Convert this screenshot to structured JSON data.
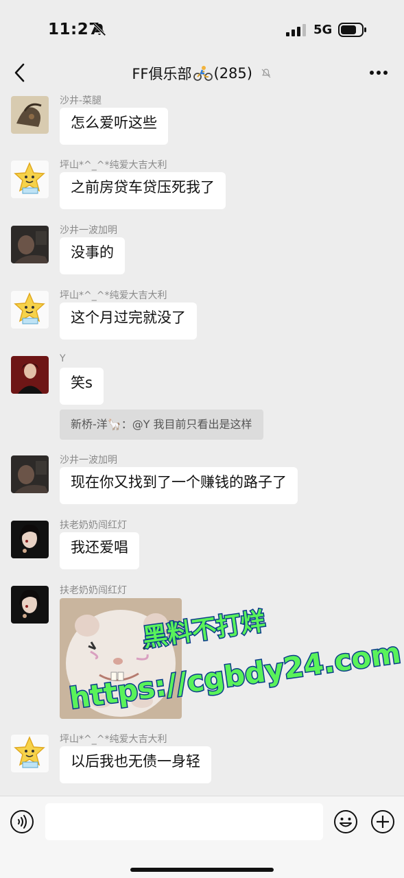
{
  "status_bar": {
    "time": "11:27",
    "network": "5G"
  },
  "header": {
    "group_name": "FF俱乐部",
    "member_count": "(285)"
  },
  "colors": {
    "background": "#ededed",
    "bubble": "#ffffff",
    "quote": "#dcdcdc",
    "sender": "#8a8a8a"
  },
  "messages": [
    {
      "sender": "沙井-菜腿",
      "text": "怎么爱听这些"
    },
    {
      "sender": "坪山*^_^*纯爱大吉大利",
      "text": "之前房贷车贷压死我了"
    },
    {
      "sender": "沙井一波加明",
      "text": "没事的"
    },
    {
      "sender": "坪山*^_^*纯爱大吉大利",
      "text": "这个月过完就没了"
    },
    {
      "sender": "Y",
      "text": "笑s",
      "quote": "新桥-洋🦙：@Y 我目前只看出是这样"
    },
    {
      "sender": "沙井一波加明",
      "text": "现在你又找到了一个赚钱的路子了"
    },
    {
      "sender": "扶老奶奶闯红灯",
      "text": "我还爱唱"
    },
    {
      "sender": "扶老奶奶闯红灯",
      "image": "hamster-photo"
    },
    {
      "sender": "坪山*^_^*纯爱大吉大利",
      "text": "以后我也无债一身轻"
    }
  ],
  "watermark": {
    "line1": "黑料不打烊",
    "line2": "https://cgbdy24.com"
  },
  "input": {
    "placeholder": ""
  },
  "icons": [
    "bell-off-icon",
    "signal-icon",
    "battery-icon",
    "back-icon",
    "bicycle-icon",
    "mute-icon",
    "more-icon",
    "voice-icon",
    "emoji-icon",
    "plus-icon"
  ]
}
